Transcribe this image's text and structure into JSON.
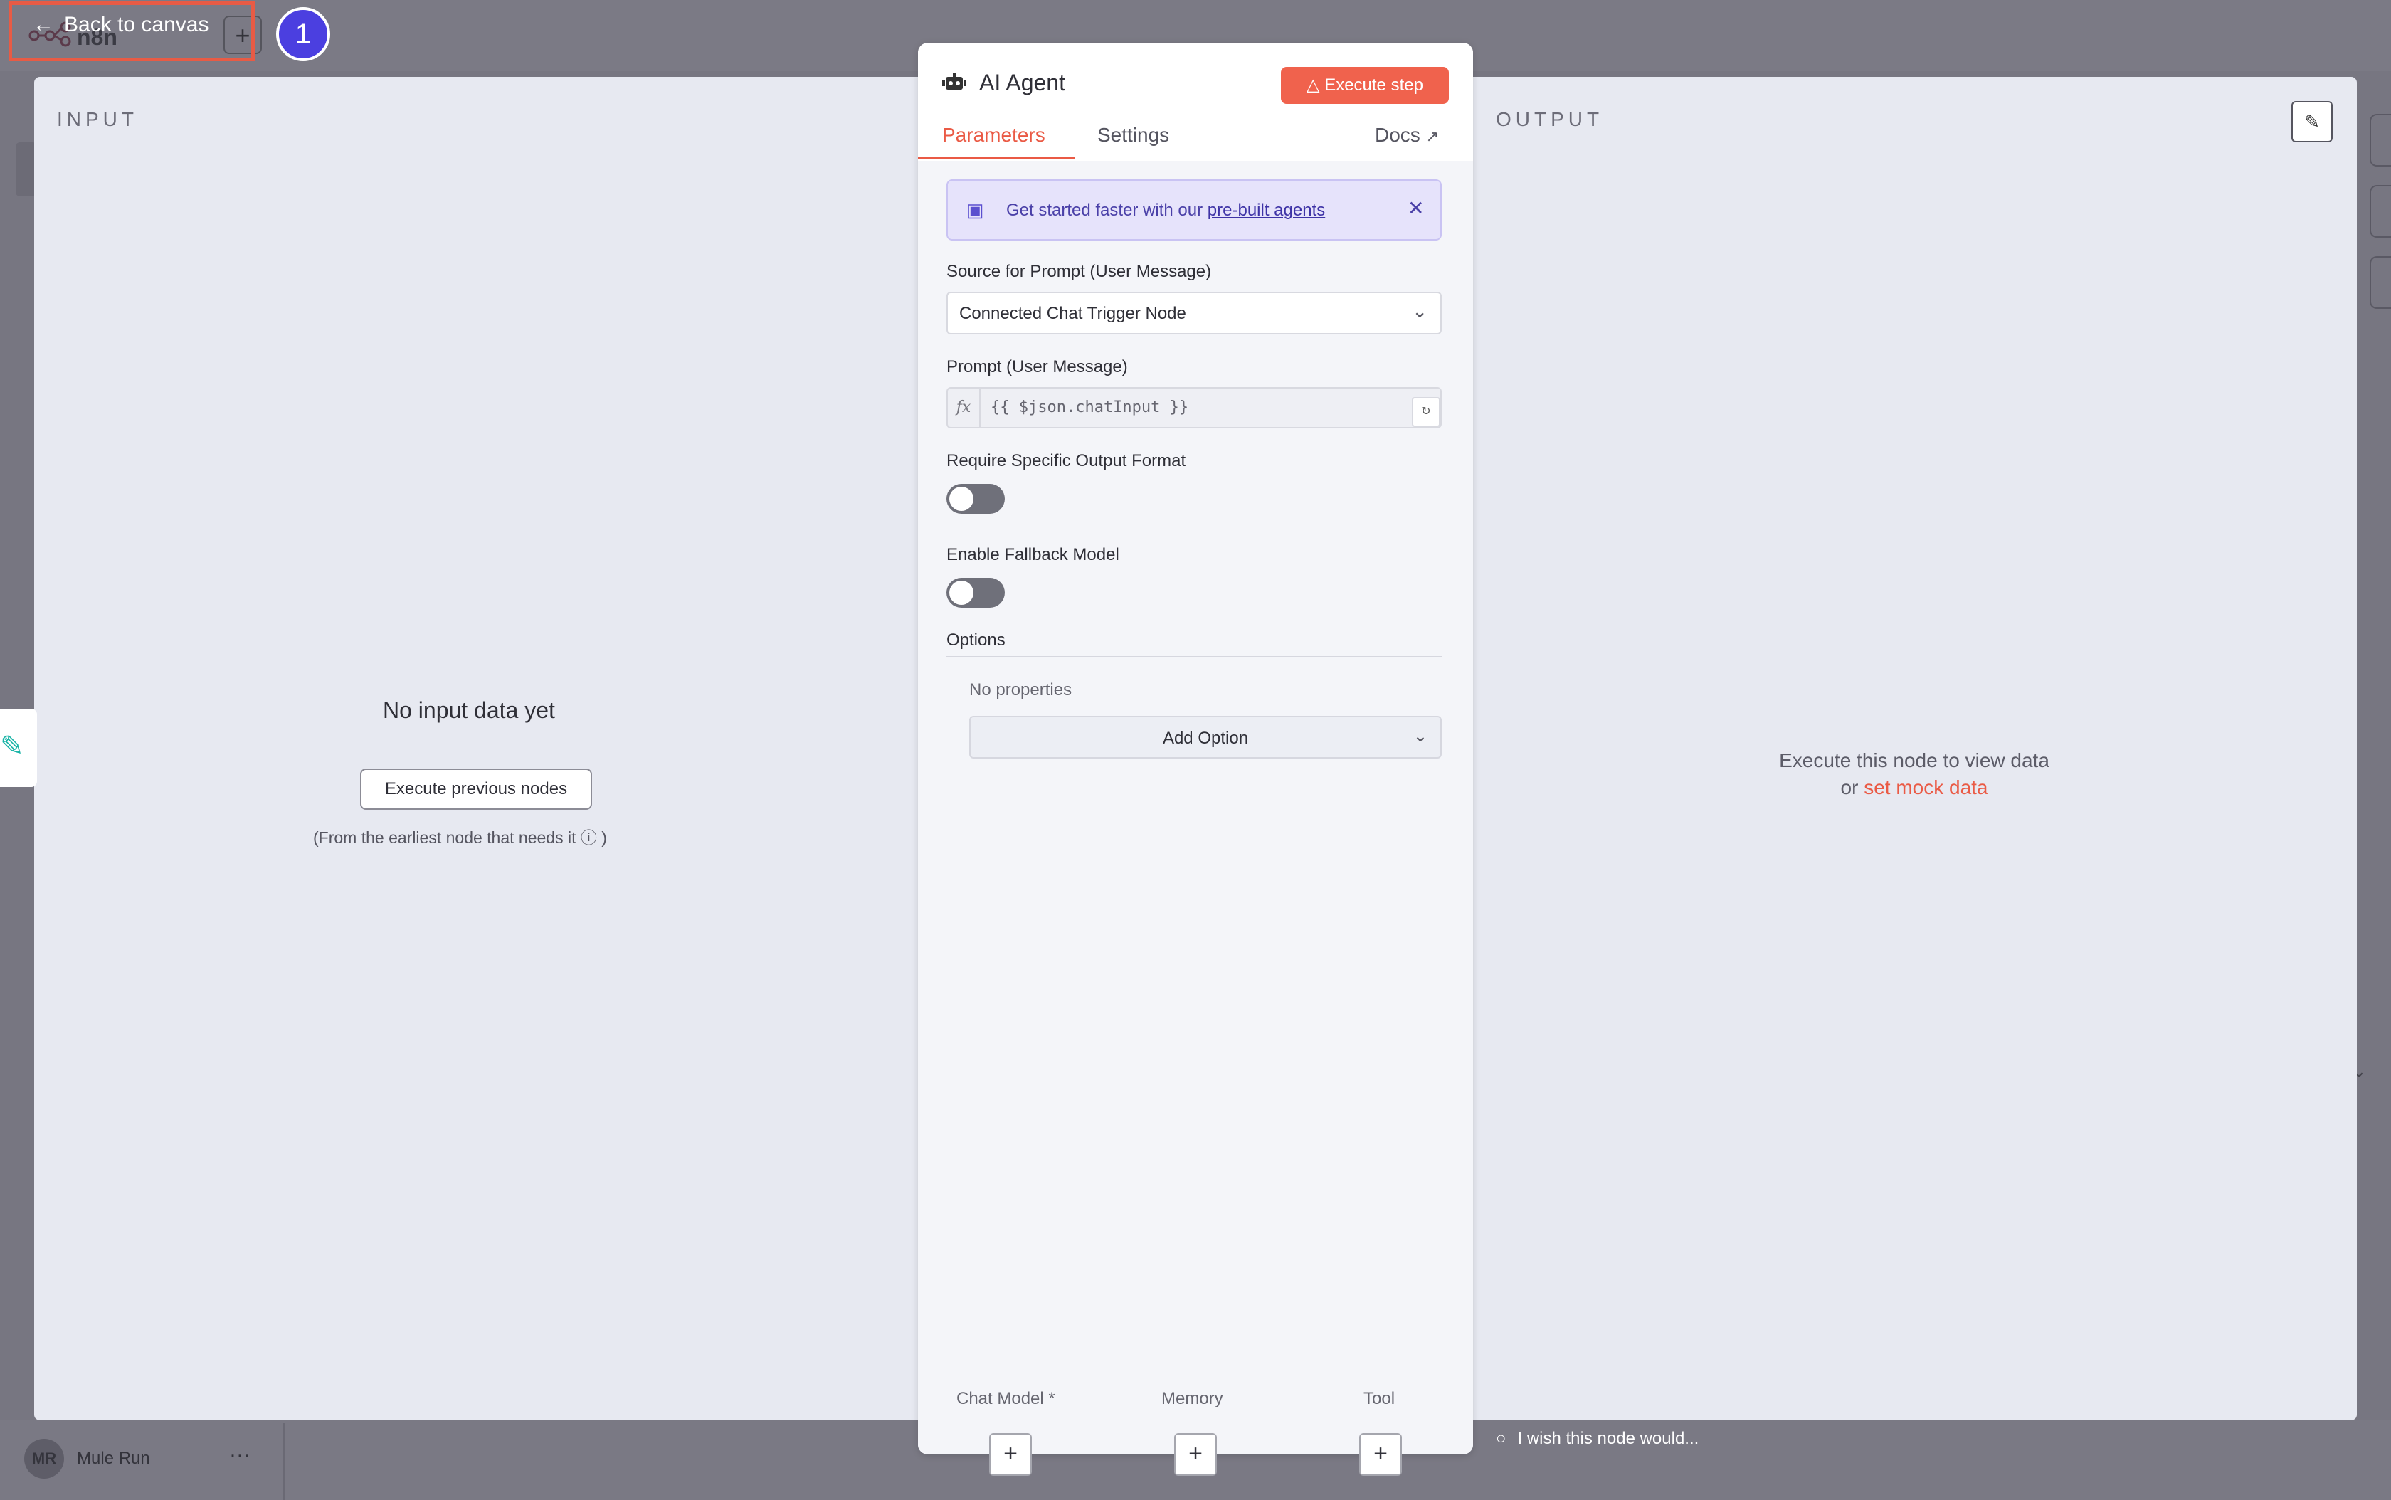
{
  "topbar": {
    "logo_text": "n8n",
    "back_label": "Back to canvas",
    "badge_number": "1"
  },
  "user": {
    "initials": "MR",
    "name": "Mule Run"
  },
  "input_panel": {
    "title": "INPUT",
    "empty_title": "No input data yet",
    "execute_previous_label": "Execute previous nodes",
    "hint": "(From the earliest node that needs it",
    "hint_close": ")"
  },
  "output_panel": {
    "title": "OUTPUT",
    "message_line1": "Execute this node to view data",
    "message_prefix": "or",
    "mock_link": "set mock data",
    "feedback": "I wish this node would..."
  },
  "node": {
    "title": "AI Agent",
    "execute_label": "Execute step",
    "tabs": {
      "parameters": "Parameters",
      "settings": "Settings",
      "docs": "Docs"
    },
    "callout": {
      "text": "Get started faster with our",
      "link": "pre-built agents"
    },
    "source_label": "Source for Prompt (User Message)",
    "source_value": "Connected Chat Trigger Node",
    "prompt_label": "Prompt (User Message)",
    "prompt_value": "{{ $json.chatInput }}",
    "output_format_label": "Require Specific Output Format",
    "fallback_label": "Enable Fallback Model",
    "options_label": "Options",
    "no_properties": "No properties",
    "add_option_label": "Add Option",
    "subnodes": {
      "chat_model": "Chat Model *",
      "memory": "Memory",
      "tool": "Tool"
    }
  },
  "colors": {
    "accent": "#ea5a45",
    "callout_bg": "#e6e3fb",
    "badge": "#4b3fe0"
  }
}
